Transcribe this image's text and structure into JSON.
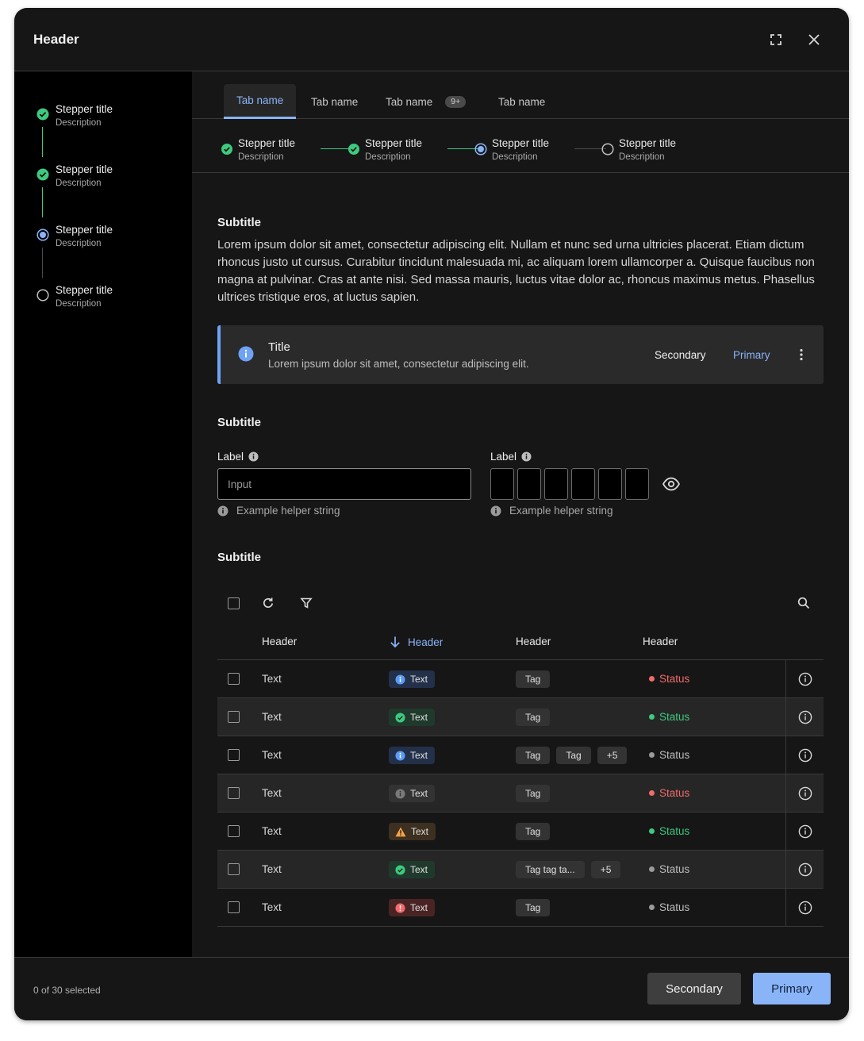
{
  "modal": {
    "title": "Header"
  },
  "sidebar_steps": [
    {
      "title": "Stepper title",
      "description": "Description",
      "state": "complete"
    },
    {
      "title": "Stepper title",
      "description": "Description",
      "state": "complete"
    },
    {
      "title": "Stepper title",
      "description": "Description",
      "state": "current"
    },
    {
      "title": "Stepper title",
      "description": "Description",
      "state": "pending"
    }
  ],
  "tabs": [
    {
      "label": "Tab name",
      "active": true
    },
    {
      "label": "Tab name"
    },
    {
      "label": "Tab name",
      "badge": "9+"
    },
    {
      "label": "Tab name"
    }
  ],
  "steps": [
    {
      "title": "Stepper title",
      "description": "Description",
      "state": "complete"
    },
    {
      "title": "Stepper title",
      "description": "Description",
      "state": "complete"
    },
    {
      "title": "Stepper title",
      "description": "Description",
      "state": "current"
    },
    {
      "title": "Stepper title",
      "description": "Description",
      "state": "pending"
    }
  ],
  "section1": {
    "subtitle": "Subtitle",
    "body": "Lorem ipsum dolor sit amet, consectetur adipiscing elit. Nullam et nunc sed urna ultricies placerat. Etiam dictum rhoncus justo ut cursus. Curabitur tincidunt malesuada mi, ac aliquam lorem ullamcorper a. Quisque faucibus non magna at pulvinar. Cras at ante nisi. Sed massa mauris, luctus vitae dolor ac, rhoncus maximus metus. Phasellus ultrices tristique eros, at luctus sapien."
  },
  "notification": {
    "title": "Title",
    "body": "Lorem ipsum dolor sit amet, consectetur adipiscing elit.",
    "secondary": "Secondary",
    "primary": "Primary"
  },
  "section2": {
    "subtitle": "Subtitle",
    "input": {
      "label": "Label",
      "placeholder": "Input",
      "helper": "Example helper string"
    },
    "pin": {
      "label": "Label",
      "helper": "Example helper string"
    }
  },
  "section3": {
    "subtitle": "Subtitle"
  },
  "table": {
    "headers": [
      "Header",
      "Header",
      "Header",
      "Header"
    ],
    "rows": [
      {
        "text": "Text",
        "chip": {
          "label": "Text",
          "kind": "info"
        },
        "tags": [
          "Tag"
        ],
        "status": {
          "label": "Status",
          "kind": "error"
        }
      },
      {
        "text": "Text",
        "chip": {
          "label": "Text",
          "kind": "success"
        },
        "tags": [
          "Tag"
        ],
        "status": {
          "label": "Status",
          "kind": "success"
        }
      },
      {
        "text": "Text",
        "chip": {
          "label": "Text",
          "kind": "info"
        },
        "tags": [
          "Tag",
          "Tag",
          "+5"
        ],
        "status": {
          "label": "Status",
          "kind": "neutral"
        }
      },
      {
        "text": "Text",
        "chip": {
          "label": "Text",
          "kind": "neutral"
        },
        "tags": [
          "Tag"
        ],
        "status": {
          "label": "Status",
          "kind": "error"
        }
      },
      {
        "text": "Text",
        "chip": {
          "label": "Text",
          "kind": "warning"
        },
        "tags": [
          "Tag"
        ],
        "status": {
          "label": "Status",
          "kind": "success"
        }
      },
      {
        "text": "Text",
        "chip": {
          "label": "Text",
          "kind": "success"
        },
        "tags": [
          "Tag tag ta...",
          "+5"
        ],
        "status": {
          "label": "Status",
          "kind": "neutral"
        }
      },
      {
        "text": "Text",
        "chip": {
          "label": "Text",
          "kind": "error"
        },
        "tags": [
          "Tag"
        ],
        "status": {
          "label": "Status",
          "kind": "neutral"
        }
      }
    ]
  },
  "footer": {
    "selection": "0 of 30 selected",
    "secondary": "Secondary",
    "primary": "Primary"
  },
  "colors": {
    "accent": "#8ab4f8",
    "success": "#3ec97e",
    "info": "#5b9bf5",
    "warning": "#f5a44a",
    "error": "#f26b6b",
    "neutral": "#9a9a9a"
  }
}
